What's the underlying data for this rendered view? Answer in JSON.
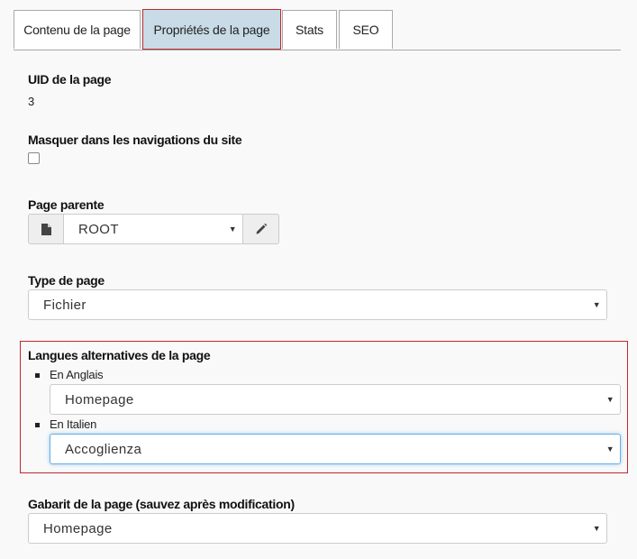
{
  "tabs": [
    {
      "label": "Contenu de la page"
    },
    {
      "label": "Propriétés de la page"
    },
    {
      "label": "Stats"
    },
    {
      "label": "SEO"
    }
  ],
  "uid": {
    "label": "UID de la page",
    "value": "3"
  },
  "hide_nav": {
    "label": "Masquer dans les navigations du site"
  },
  "parent": {
    "label": "Page parente",
    "value": "ROOT",
    "file_icon": "file-icon",
    "edit_icon": "pencil-icon"
  },
  "page_type": {
    "label": "Type de page",
    "value": "Fichier"
  },
  "alt_langs": {
    "label": "Langues alternatives de la page",
    "items": [
      {
        "label": "En Anglais",
        "value": "Homepage"
      },
      {
        "label": "En Italien",
        "value": "Accoglienza"
      }
    ]
  },
  "template": {
    "label": "Gabarit de la page (sauvez après modification)",
    "value": "Homepage"
  }
}
